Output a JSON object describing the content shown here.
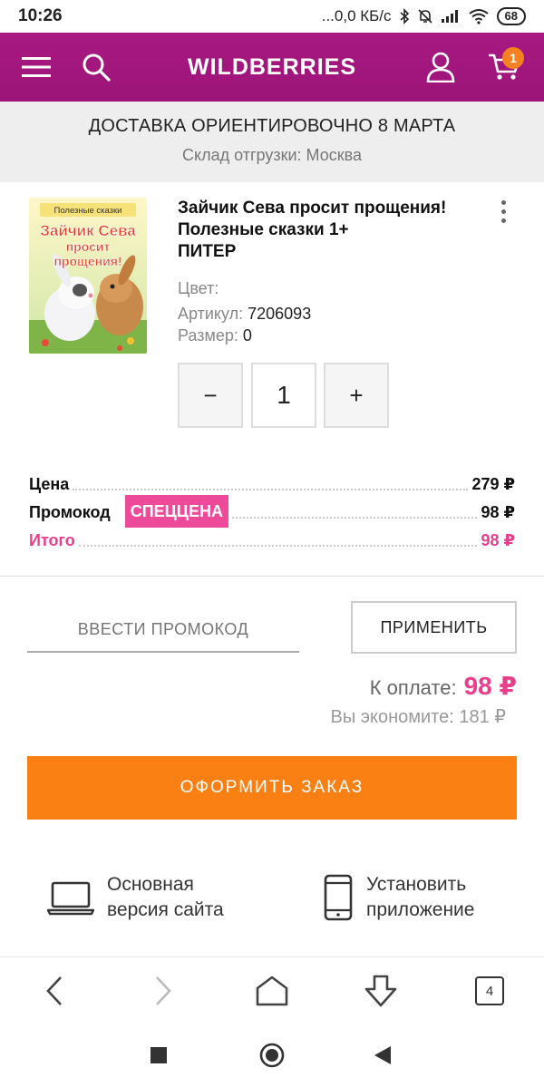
{
  "status_bar": {
    "time": "10:26",
    "network": "...0,0 КБ/с",
    "battery": "68"
  },
  "header": {
    "logo": "WILDBERRIES",
    "cart_count": "1"
  },
  "delivery": {
    "title": "ДОСТАВКА ОРИЕНТИРОВОЧНО 8 МАРТА",
    "warehouse": "Склад отгрузки: Москва"
  },
  "product": {
    "title_line1": "Зайчик Сева просит прощения!",
    "title_line2": "Полезные сказки 1+",
    "brand": "ПИТЕР",
    "color_label": "Цвет:",
    "article_label": "Артикул:",
    "article_value": "7206093",
    "size_label": "Размер:",
    "size_value": "0",
    "cover_series": "Полезные сказки",
    "cover_title_1": "Зайчик Сева",
    "cover_title_2": "просит",
    "cover_title_3": "прощения!"
  },
  "quantity": {
    "minus": "−",
    "value": "1",
    "plus": "+"
  },
  "prices": {
    "price_label": "Цена",
    "price_value": "279 ₽",
    "promo_label": "Промокод",
    "promo_badge": "СПЕЦЦЕНА",
    "promo_value": "98 ₽",
    "total_label": "Итого",
    "total_value": "98 ₽"
  },
  "promo": {
    "placeholder": "ВВЕСТИ ПРОМОКОД",
    "apply_label": "ПРИМЕНИТЬ"
  },
  "payment": {
    "label": "К оплате:",
    "amount": "98 ₽",
    "savings": "Вы экономите: 181 ₽"
  },
  "order_button": "ОФОРМИТЬ ЗАКАЗ",
  "footer": {
    "desktop_line1": "Основная",
    "desktop_line2": "версия сайта",
    "app_line1": "Установить",
    "app_line2": "приложение"
  },
  "browser_nav": {
    "tabs_count": "4"
  },
  "colors": {
    "brand": "#a0167a",
    "accent_pink": "#e83e8c",
    "order_orange": "#fb8013",
    "badge_orange": "#f58220"
  }
}
